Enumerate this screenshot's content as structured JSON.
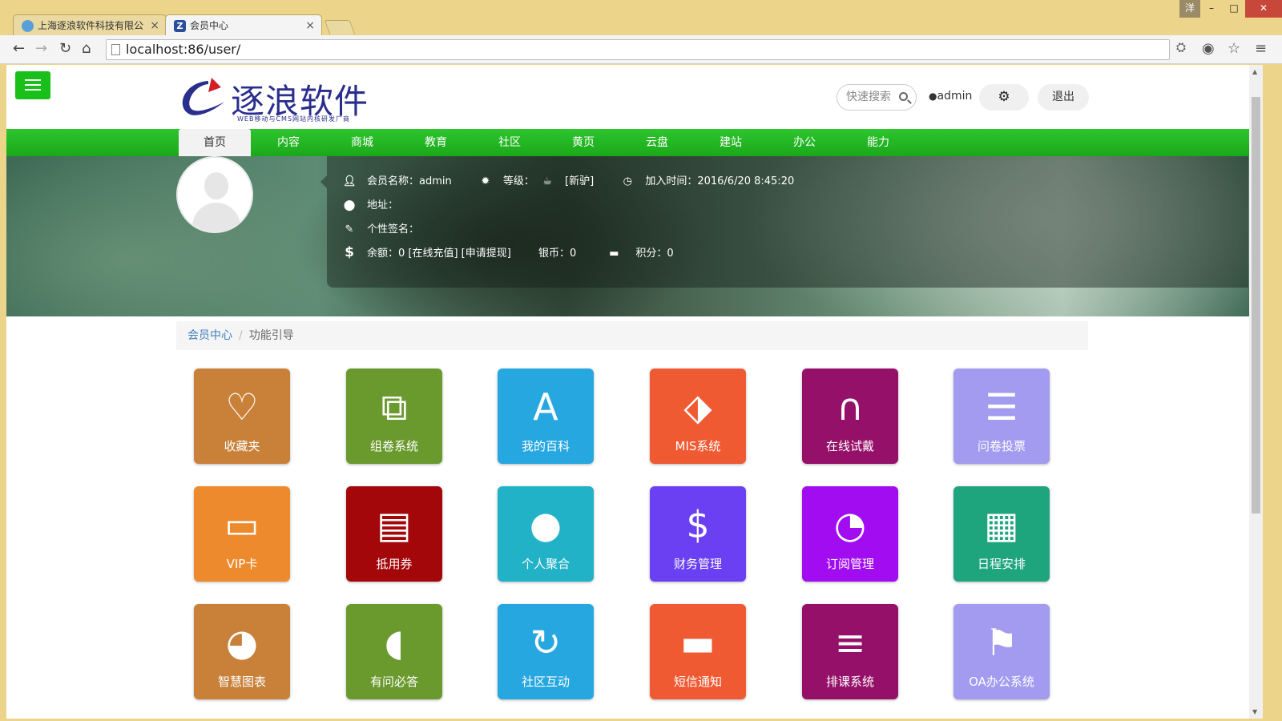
{
  "browser": {
    "tabs": [
      {
        "title": "上海逐浪软件科技有限公",
        "active": false
      },
      {
        "title": "会员中心",
        "active": true
      }
    ],
    "window_badge": "洋",
    "url": "localhost:86/user/"
  },
  "header": {
    "logo_text": "逐浪软件",
    "logo_sub": "WEB移动与CMS网站内核研发厂商",
    "search_placeholder": "快速搜索",
    "username": "admin",
    "logout_label": "退出"
  },
  "nav": [
    "首页",
    "内容",
    "商城",
    "教育",
    "社区",
    "黄页",
    "云盘",
    "建站",
    "办公",
    "能力"
  ],
  "profile": {
    "name_label": "会员名称：admin",
    "level_label": "等级：",
    "level_value": "[新驴]",
    "join_label": "加入时间：2016/6/20 8:45:20",
    "address_label": "地址：",
    "signature_label": "个性签名：",
    "balance_label": "余额：0 [在线充值] [申请提现]",
    "silver_label": "银币：0",
    "points_label": "积分：0"
  },
  "breadcrumb": {
    "home": "会员中心",
    "current": "功能引导"
  },
  "tiles": [
    {
      "label": "收藏夹",
      "icon": "heart-icon",
      "glyph": "♡",
      "color": "#c9813a"
    },
    {
      "label": "组卷系统",
      "icon": "copy-icon",
      "glyph": "⧉",
      "color": "#6a9a2e"
    },
    {
      "label": "我的百科",
      "icon": "font-icon",
      "glyph": "A",
      "color": "#26a7e0"
    },
    {
      "label": "MIS系统",
      "icon": "tags-icon",
      "glyph": "⬗",
      "color": "#f05a32"
    },
    {
      "label": "在线试戴",
      "icon": "headphones-icon",
      "glyph": "∩",
      "color": "#951068"
    },
    {
      "label": "问卷投票",
      "icon": "list-alt-icon",
      "glyph": "☰",
      "color": "#a39bf0"
    },
    {
      "label": "VIP卡",
      "icon": "credit-card-icon",
      "glyph": "▭",
      "color": "#ee8a2e"
    },
    {
      "label": "抵用券",
      "icon": "file-text-icon",
      "glyph": "▤",
      "color": "#a4070a"
    },
    {
      "label": "个人聚合",
      "icon": "users-icon",
      "glyph": "●",
      "color": "#22b2c8"
    },
    {
      "label": "财务管理",
      "icon": "dollar-icon",
      "glyph": "$",
      "color": "#6a40f2"
    },
    {
      "label": "订阅管理",
      "icon": "rss-icon",
      "glyph": "◔",
      "color": "#a10df0"
    },
    {
      "label": "日程安排",
      "icon": "calendar-icon",
      "glyph": "▦",
      "color": "#1fa57e"
    },
    {
      "label": "智慧图表",
      "icon": "pie-chart-icon",
      "glyph": "◕",
      "color": "#c9813a"
    },
    {
      "label": "有问必答",
      "icon": "comments-icon",
      "glyph": "◖",
      "color": "#6a9a2e"
    },
    {
      "label": "社区互动",
      "icon": "refresh-icon",
      "glyph": "↻",
      "color": "#26a7e0"
    },
    {
      "label": "短信通知",
      "icon": "comment-icon",
      "glyph": "▬",
      "color": "#f05a32"
    },
    {
      "label": "排课系统",
      "icon": "tasks-icon",
      "glyph": "≡",
      "color": "#951068"
    },
    {
      "label": "OA办公系统",
      "icon": "flag-icon",
      "glyph": "⚑",
      "color": "#a39bf0"
    }
  ]
}
